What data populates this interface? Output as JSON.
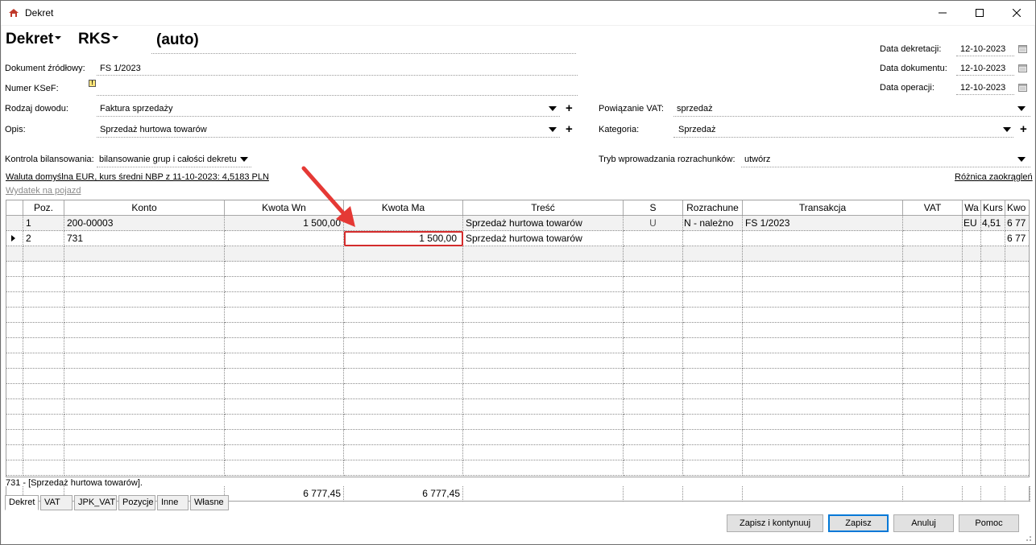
{
  "window": {
    "title": "Dekret",
    "minimize_icon": "minimize-icon",
    "maximize_icon": "maximize-icon",
    "close_icon": "close-icon"
  },
  "header": {
    "doc_type": "Dekret",
    "journal": "RKS",
    "number": "(auto)"
  },
  "fields": {
    "dokument_zrodlowy_label": "Dokument źródłowy:",
    "dokument_zrodlowy_value": "FS 1/2023",
    "numer_ksef_label": "Numer KSeF:",
    "rodzaj_dowodu_label": "Rodzaj dowodu:",
    "rodzaj_dowodu_value": "Faktura sprzedaży",
    "opis_label": "Opis:",
    "opis_value": "Sprzedaż hurtowa towarów",
    "kontrola_label": "Kontrola bilansowania:",
    "kontrola_value": "bilansowanie grup i całości dekretu",
    "powiazanie_label": "Powiązanie VAT:",
    "powiazanie_value": "sprzedaż",
    "kategoria_label": "Kategoria:",
    "kategoria_value": "Sprzedaż",
    "tryb_label": "Tryb wprowadzania rozrachunków:",
    "tryb_value": "utwórz",
    "data_dekretacji_label": "Data dekretacji:",
    "data_dekretacji_value": "12-10-2023",
    "data_dokumentu_label": "Data dokumentu:",
    "data_dokumentu_value": "12-10-2023",
    "data_operacji_label": "Data operacji:",
    "data_operacji_value": "12-10-2023"
  },
  "links": {
    "waluta": "Waluta domyślna EUR, kurs średni NBP z 11-10-2023: 4,5183 PLN",
    "wydatek": "Wydatek na pojazd",
    "roznica": "Różnica zaokrągleń"
  },
  "grid": {
    "columns": [
      "Poz.",
      "Konto",
      "Kwota Wn",
      "Kwota Ma",
      "Treść",
      "S",
      "Rozrachune",
      "Transakcja",
      "VAT",
      "Wa",
      "Kurs",
      "Kwo"
    ],
    "rows": [
      {
        "poz": "1",
        "konto": "200-00003",
        "wn": "1 500,00",
        "ma": "",
        "tresc": "Sprzedaż hurtowa towarów",
        "s": "U",
        "rozrach": "N - należno",
        "transakcja": "FS 1/2023",
        "vat": "",
        "wa": "EU",
        "kurs": "4,51",
        "kwo": "6 77"
      },
      {
        "poz": "2",
        "konto": "731",
        "wn": "",
        "ma": "1 500,00",
        "tresc": "Sprzedaż hurtowa towarów",
        "s": "",
        "rozrach": "",
        "transakcja": "",
        "vat": "",
        "wa": "",
        "kurs": "",
        "kwo": "6 77"
      }
    ],
    "totals": {
      "wn": "6 777,45",
      "ma": "6 777,45"
    }
  },
  "status": "731 - [Sprzedaż hurtowa towarów].",
  "tabs": [
    "Dekret",
    "VAT",
    "JPK_VAT",
    "Pozycje",
    "Inne",
    "Własne"
  ],
  "buttons": {
    "zapisz_kontynuuj": "Zapisz i kontynuuj",
    "zapisz": "Zapisz",
    "anuluj": "Anuluj",
    "pomoc": "Pomoc"
  },
  "colors": {
    "annotation_red": "#e53935",
    "selection_outline": "#d42c2c"
  }
}
